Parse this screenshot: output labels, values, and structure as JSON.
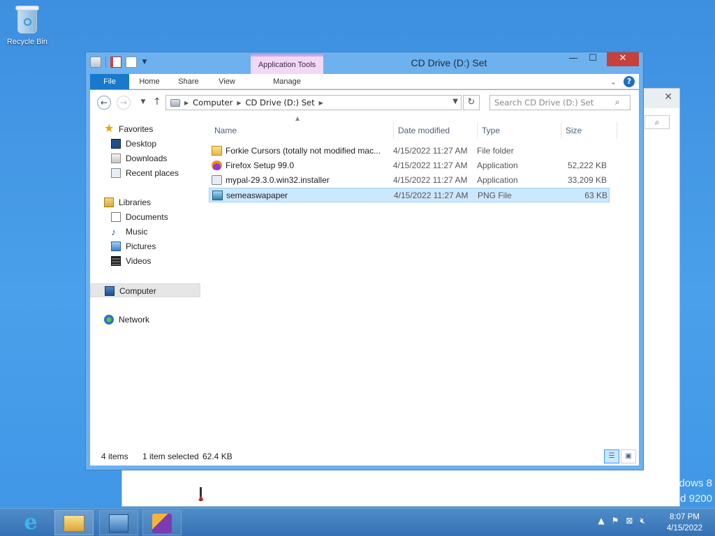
{
  "desktop": {
    "recycle_bin_label": "Recycle Bin",
    "watermark_line1": "dows 8",
    "watermark_line2": "d 9200"
  },
  "window": {
    "title": "CD Drive (D:) Set",
    "context_tab": "Application Tools",
    "controls": {
      "minimize": "—",
      "maximize": "☐",
      "close": "✕"
    }
  },
  "ribbon": {
    "tabs": [
      {
        "label": "File"
      },
      {
        "label": "Home"
      },
      {
        "label": "Share"
      },
      {
        "label": "View"
      },
      {
        "label": "Manage"
      }
    ],
    "help": "?"
  },
  "address": {
    "crumbs": [
      "Computer",
      "CD Drive (D:) Set"
    ],
    "search_placeholder": "Search CD Drive (D:) Set"
  },
  "nav_pane": {
    "favorites": {
      "label": "Favorites",
      "items": [
        "Desktop",
        "Downloads",
        "Recent places"
      ]
    },
    "libraries": {
      "label": "Libraries",
      "items": [
        "Documents",
        "Music",
        "Pictures",
        "Videos"
      ]
    },
    "computer": "Computer",
    "network": "Network"
  },
  "files": {
    "columns": [
      "Name",
      "Date modified",
      "Type",
      "Size"
    ],
    "rows": [
      {
        "name": "Forkie Cursors (totally not modified mac...",
        "date": "4/15/2022 11:27 AM",
        "type": "File folder",
        "size": "",
        "icon": "folder-icon"
      },
      {
        "name": "Firefox Setup 99.0",
        "date": "4/15/2022 11:27 AM",
        "type": "Application",
        "size": "52,222 KB",
        "icon": "firefox-icon"
      },
      {
        "name": "mypal-29.3.0.win32.installer",
        "date": "4/15/2022 11:27 AM",
        "type": "Application",
        "size": "33,209 KB",
        "icon": "installer-icon"
      },
      {
        "name": "semeaswapaper",
        "date": "4/15/2022 11:27 AM",
        "type": "PNG File",
        "size": "63 KB",
        "icon": "png-image-icon",
        "selected": true
      }
    ]
  },
  "status": {
    "items_count": "4 items",
    "selected": "1 item selected",
    "selected_size": "62.4 KB"
  },
  "taskbar": {
    "time": "8:07 PM",
    "date": "4/15/2022"
  }
}
